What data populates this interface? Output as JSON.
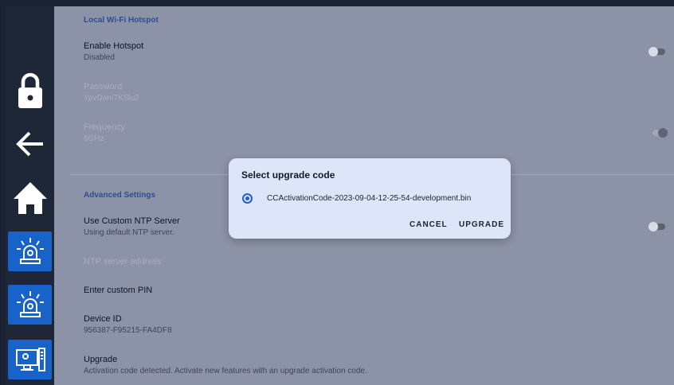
{
  "sidebar": {
    "items": [
      {
        "icon": "lock-icon"
      },
      {
        "icon": "back-arrow-icon"
      },
      {
        "icon": "home-icon"
      },
      {
        "icon": "alarm-beacon-icon"
      },
      {
        "icon": "alarm-beacon-icon"
      },
      {
        "icon": "computer-monitor-icon"
      }
    ]
  },
  "settings": {
    "hotspot_header": "Local Wi-Fi Hotspot",
    "enable_hotspot": {
      "title": "Enable Hotspot",
      "value": "Disabled"
    },
    "password": {
      "title": "Password",
      "value": "YpvDam7KSlu2"
    },
    "frequency": {
      "title": "Frequency",
      "value": "5GHz"
    },
    "advanced_header": "Advanced Settings",
    "ntp": {
      "title": "Use Custom NTP Server",
      "value": "Using default NTP server."
    },
    "ntp_address": {
      "title": "NTP server address"
    },
    "custom_pin": {
      "title": "Enter custom PIN"
    },
    "device_id": {
      "title": "Device ID",
      "value": "956387-F95215-FA4DF8"
    },
    "upgrade": {
      "title": "Upgrade",
      "value": "Activation code detected. Activate new features with an upgrade activation code."
    }
  },
  "dialog": {
    "title": "Select upgrade code",
    "option": "CCActivationCode-2023-09-04-12-25-54-development.bin",
    "cancel": "CANCEL",
    "upgrade": "UPGRADE"
  },
  "colors": {
    "accent": "#1763c9",
    "sidebar": "#1e2738",
    "dialog": "#dde6f8"
  }
}
